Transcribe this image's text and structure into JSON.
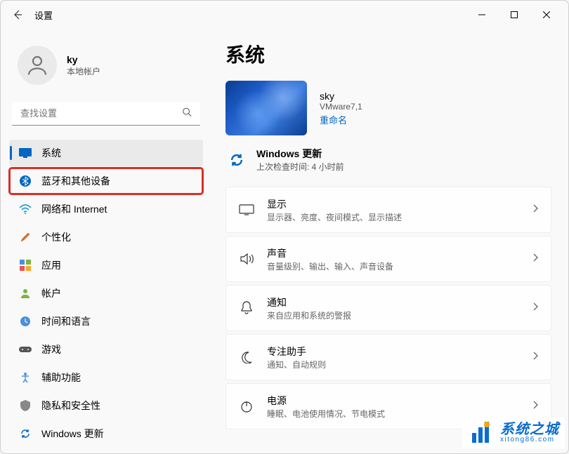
{
  "window": {
    "title": "设置"
  },
  "user": {
    "name": "ky",
    "account_type": "本地帐户"
  },
  "search": {
    "placeholder": "查找设置"
  },
  "nav": {
    "items": [
      {
        "label": "系统",
        "icon": "system"
      },
      {
        "label": "蓝牙和其他设备",
        "icon": "bluetooth"
      },
      {
        "label": "网络和 Internet",
        "icon": "wifi"
      },
      {
        "label": "个性化",
        "icon": "brush"
      },
      {
        "label": "应用",
        "icon": "apps"
      },
      {
        "label": "帐户",
        "icon": "person"
      },
      {
        "label": "时间和语言",
        "icon": "time"
      },
      {
        "label": "游戏",
        "icon": "game"
      },
      {
        "label": "辅助功能",
        "icon": "accessibility"
      },
      {
        "label": "隐私和安全性",
        "icon": "shield"
      },
      {
        "label": "Windows 更新",
        "icon": "update"
      }
    ],
    "selected_index": 0,
    "highlighted_index": 1
  },
  "page": {
    "title": "系统",
    "device": {
      "name": "sky",
      "model": "VMware7,1",
      "rename_label": "重命名"
    },
    "update": {
      "title": "Windows 更新",
      "subtitle": "上次检查时间: 4 小时前"
    },
    "settings": [
      {
        "title": "显示",
        "subtitle": "显示器、亮度、夜间模式、显示描述",
        "icon": "display"
      },
      {
        "title": "声音",
        "subtitle": "音量级别、输出、输入、声音设备",
        "icon": "sound"
      },
      {
        "title": "通知",
        "subtitle": "来自应用和系统的警报",
        "icon": "bell"
      },
      {
        "title": "专注助手",
        "subtitle": "通知、自动规则",
        "icon": "moon"
      },
      {
        "title": "电源",
        "subtitle": "睡眠、电池使用情况、节电模式",
        "icon": "power"
      }
    ]
  },
  "watermark": {
    "main": "系统之城",
    "sub": "xitong86.com"
  }
}
